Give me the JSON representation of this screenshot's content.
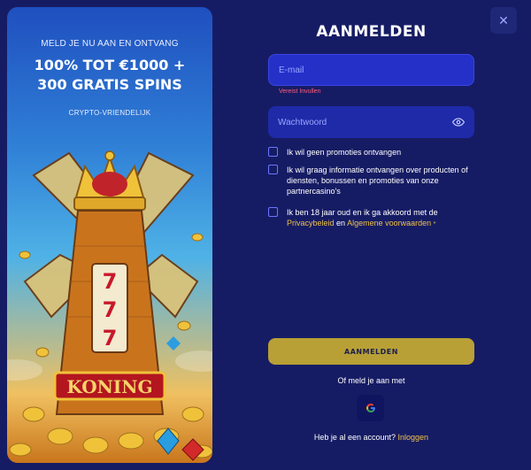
{
  "promo": {
    "kicker": "MELD JE NU AAN EN ONTVANG",
    "title_line1": "100% TOT €1000 +",
    "title_line2": "300 GRATIS SPINS",
    "tag": "CRYPTO-VRIENDELIJK",
    "sign_text": "KONING",
    "reel_symbol": "7"
  },
  "dialog": {
    "close_icon": "close-icon",
    "title": "AANMELDEN"
  },
  "form": {
    "email_placeholder": "E-mail",
    "email_error": "Vereist Invullen",
    "password_placeholder": "Wachtwoord",
    "password_toggle_icon": "eye-icon",
    "checkbox_no_promos": "Ik wil geen promoties ontvangen",
    "checkbox_partner_info": "Ik wil graag informatie ontvangen over producten of diensten, bonussen en promoties van onze partnercasino's",
    "checkbox_terms_prefix": "Ik ben 18 jaar oud en ik ga akkoord met de",
    "privacy_link": "Privacybeleid",
    "terms_and": "en",
    "terms_link": "Algemene voorwaarden",
    "required_mark": "*",
    "submit_label": "AANMELDEN",
    "alt_signup_label": "Of meld je aan met",
    "google_icon": "google-icon",
    "google_letter": "G",
    "have_account": "Heb je al een account?",
    "login_link": "Inloggen"
  },
  "colors": {
    "background": "#161c64",
    "input": "#2430c8",
    "accent": "#f1c24a",
    "submit": "#b8a036",
    "error": "#ff5d7a"
  }
}
